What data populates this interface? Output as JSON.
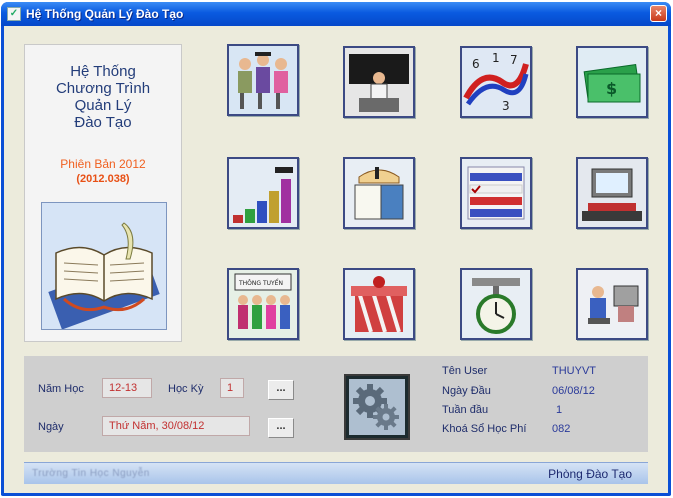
{
  "window": {
    "title": "Hệ Thống Quản Lý Đào Tạo",
    "close_label": "×"
  },
  "left_panel": {
    "app_name": "Hệ Thống\nChương Trình\nQuản Lý\nĐào Tạo",
    "version": "Phiên Bản 2012",
    "build": "(2012.038)"
  },
  "modules": [
    {
      "icon": "graduates-icon"
    },
    {
      "icon": "teacher-blackboard-icon"
    },
    {
      "icon": "schedule-numbers-icon"
    },
    {
      "icon": "money-icon"
    },
    {
      "icon": "stacked-books-icon"
    },
    {
      "icon": "calendar-book-icon"
    },
    {
      "icon": "checklist-icon"
    },
    {
      "icon": "computer-lab-icon"
    },
    {
      "icon": "enrollment-board-icon"
    },
    {
      "icon": "gift-box-icon"
    },
    {
      "icon": "scale-clock-icon"
    },
    {
      "icon": "computer-user-icon"
    }
  ],
  "form": {
    "nam_hoc_label": "Năm Học",
    "nam_hoc_value": "12-13",
    "hoc_ky_label": "Học Kỳ",
    "hoc_ky_value": "1",
    "ngay_label": "Ngày",
    "ngay_value": "Thứ Năm, 30/08/12",
    "dots_label": "..."
  },
  "info": {
    "ten_user_label": "Tên User",
    "ten_user_value": "THUYVT",
    "ngay_dau_label": "Ngày Đầu",
    "ngay_dau_value": "06/08/12",
    "tuan_dau_label": "Tuần đầu",
    "tuan_dau_value": "1",
    "khoa_so_label": "Khoá Sổ Học Phí",
    "khoa_so_value": "082"
  },
  "statusbar": {
    "left_text": "Trường Tin Học Nguyễn",
    "right_text": "Phòng Đào Tạo"
  }
}
